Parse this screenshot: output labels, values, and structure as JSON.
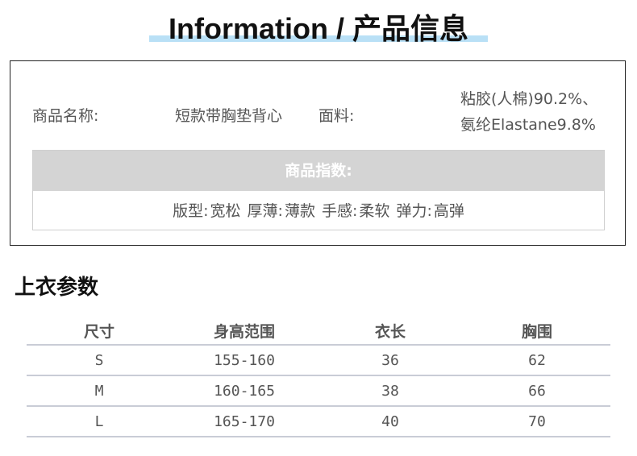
{
  "header": {
    "title": "Information / 产品信息"
  },
  "product": {
    "name_label": "商品名称:",
    "name_value": "短款带胸垫背心",
    "fabric_label": "面料:",
    "fabric_line1": "粘胶(人棉)90.2%、",
    "fabric_line2": "氨纶Elastane9.8%"
  },
  "index": {
    "heading": "商品指数:",
    "items": [
      {
        "label": "版型:",
        "value": "宽松"
      },
      {
        "label": "厚薄:",
        "value": "薄款"
      },
      {
        "label": "手感:",
        "value": "柔软"
      },
      {
        "label": "弹力:",
        "value": "高弹"
      }
    ]
  },
  "size_section": {
    "title": "上衣参数",
    "headers": [
      "尺寸",
      "身高范围",
      "衣长",
      "胸围"
    ],
    "rows": [
      [
        "S",
        "155-160",
        "36",
        "62"
      ],
      [
        "M",
        "160-165",
        "38",
        "66"
      ],
      [
        "L",
        "165-170",
        "40",
        "70"
      ]
    ]
  },
  "colors": {
    "accent_bar": "#b9e0f6",
    "index_header_bg": "#d4d4d4",
    "table_rule": "#c9ccd6"
  }
}
